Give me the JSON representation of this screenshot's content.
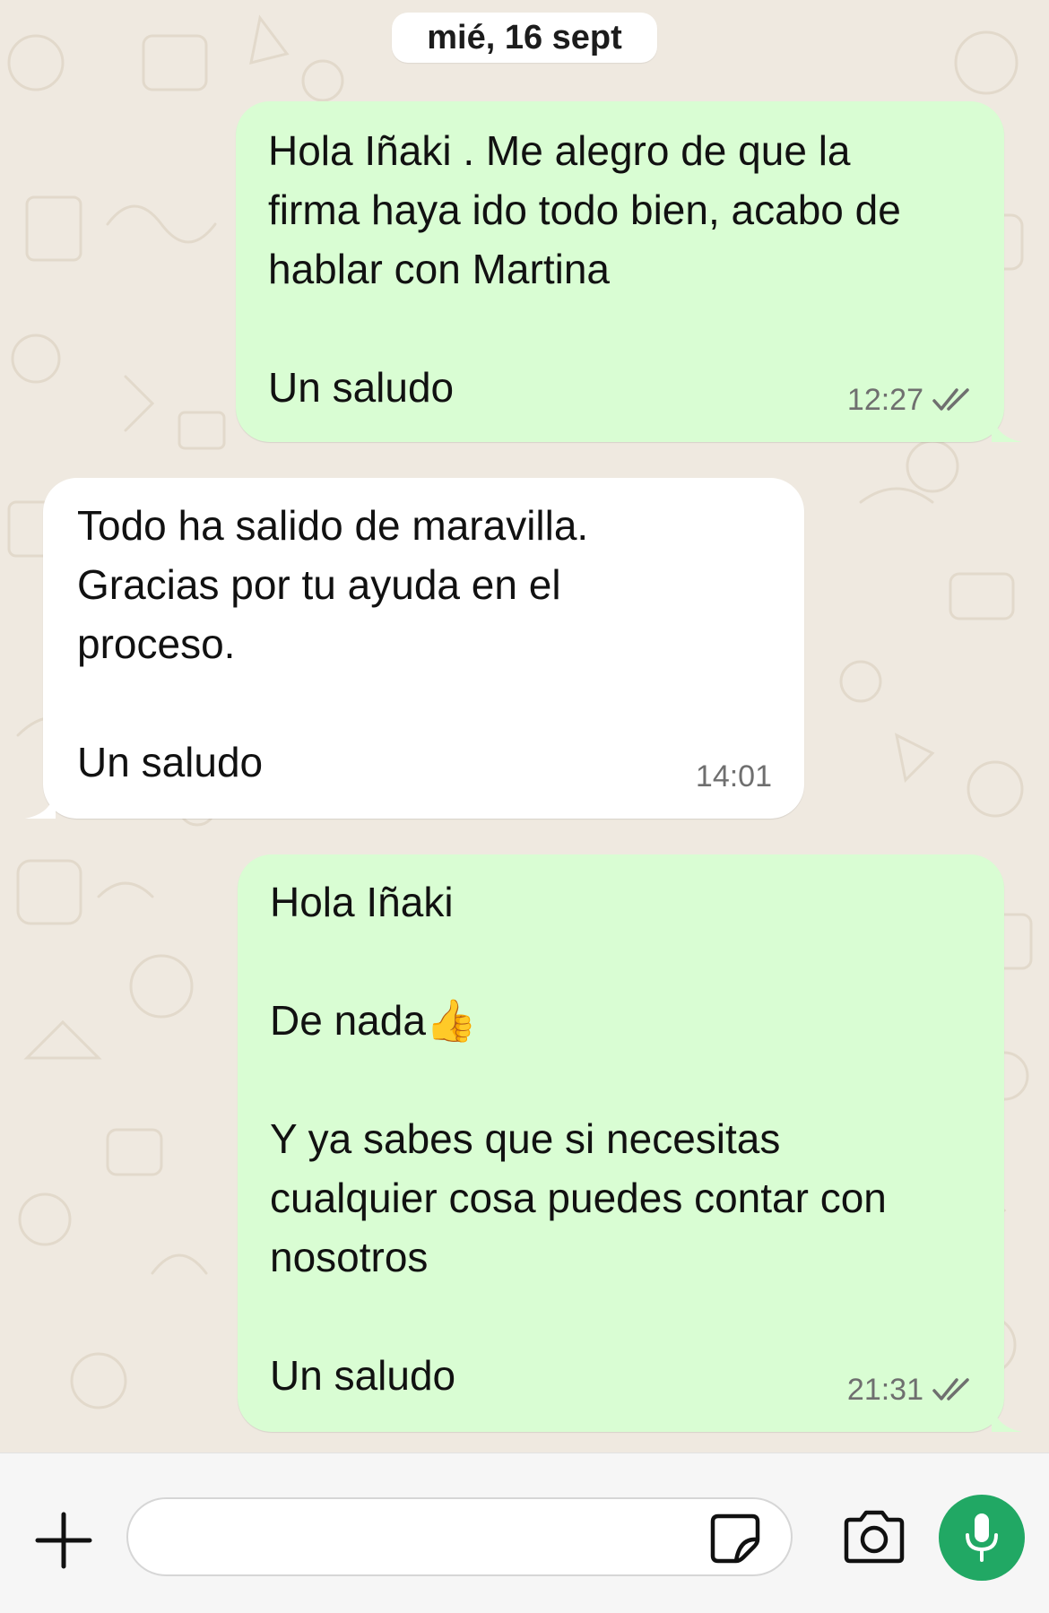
{
  "chat": {
    "date_separator": "mié, 16 sept",
    "messages": [
      {
        "direction": "outgoing",
        "text": "Hola Iñaki . Me alegro de que la\nfirma haya ido todo bien, acabo de\nhablar con Martina\n\nUn saludo",
        "time": "12:27",
        "status_icon": "double-check-icon"
      },
      {
        "direction": "incoming",
        "text": "Todo ha salido de maravilla.\nGracias por tu ayuda en el\nproceso.\n\nUn saludo",
        "time": "14:01"
      },
      {
        "direction": "outgoing",
        "text": "Hola Iñaki\n\nDe nada👍\n\nY ya sabes que si necesitas\ncualquier cosa puedes contar con\nnosotros\n\nUn saludo",
        "time": "21:31",
        "status_icon": "double-check-icon"
      }
    ]
  },
  "composer": {
    "input_value": "",
    "icons": [
      "plus-icon",
      "sticker-icon",
      "camera-icon",
      "microphone-icon"
    ]
  },
  "colors": {
    "outgoing_bubble": "#d9fdd3",
    "incoming_bubble": "#ffffff",
    "wallpaper": "#efe9e0",
    "mic_button": "#21a864"
  }
}
